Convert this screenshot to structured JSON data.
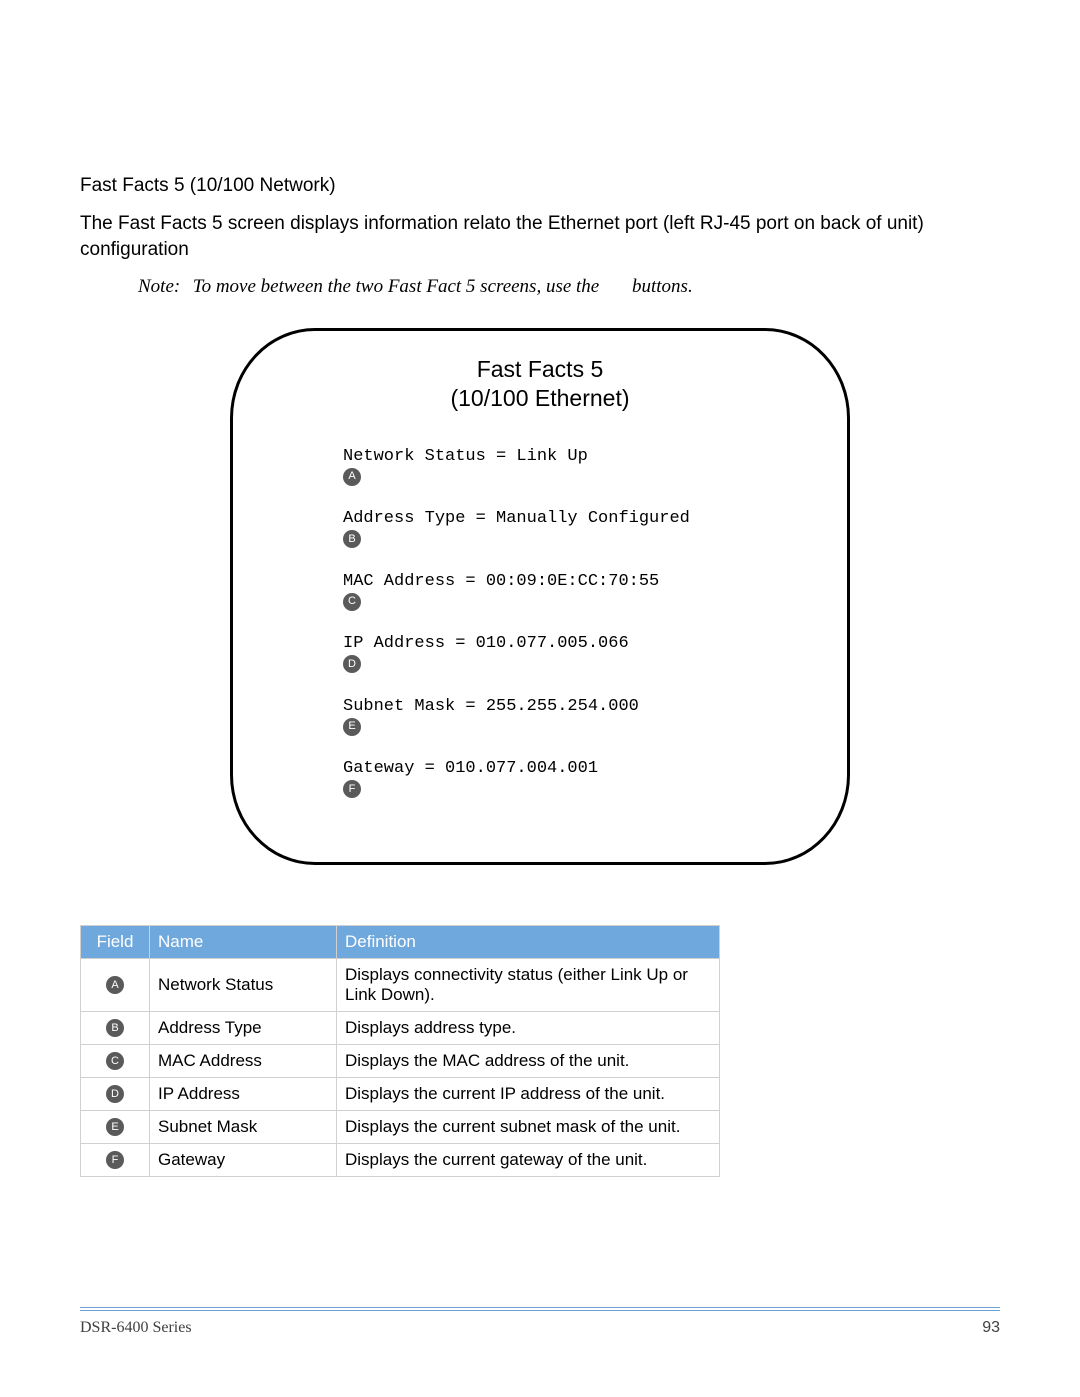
{
  "section_heading": "Fast Facts 5 (10/100 Network)",
  "intro": "The Fast Facts 5 screen displays information relato the Ethernet port (left RJ-45 port on back of unit) configuration",
  "note": {
    "label": "Note:",
    "text": "To move between the two Fast Fact 5 screens, use the",
    "tail": "buttons."
  },
  "screen": {
    "title_line1": "Fast Facts 5",
    "title_line2": "(10/100 Ethernet)",
    "rows": [
      {
        "badge": "A",
        "text": "Network Status = Link Up"
      },
      {
        "badge": "B",
        "text": "Address Type = Manually Configured"
      },
      {
        "badge": "C",
        "text": "MAC Address = 00:09:0E:CC:70:55"
      },
      {
        "badge": "D",
        "text": "IP Address = 010.077.005.066"
      },
      {
        "badge": "E",
        "text": "Subnet Mask = 255.255.254.000"
      },
      {
        "badge": "F",
        "text": "Gateway = 010.077.004.001"
      }
    ]
  },
  "table": {
    "headers": {
      "field": "Field",
      "name": "Name",
      "definition": "Definition"
    },
    "rows": [
      {
        "badge": "A",
        "name": "Network Status",
        "definition": "Displays connectivity status (either Link Up or Link Down)."
      },
      {
        "badge": "B",
        "name": "Address Type",
        "definition": "Displays address type."
      },
      {
        "badge": "C",
        "name": "MAC Address",
        "definition": "Displays the MAC address of the unit."
      },
      {
        "badge": "D",
        "name": "IP Address",
        "definition": "Displays the current IP address of the unit."
      },
      {
        "badge": "E",
        "name": "Subnet Mask",
        "definition": "Displays the current subnet mask of the unit."
      },
      {
        "badge": "F",
        "name": "Gateway",
        "definition": "Displays the current gateway of the unit."
      }
    ]
  },
  "footer": {
    "product": "DSR-6400 Series",
    "page": "93"
  }
}
